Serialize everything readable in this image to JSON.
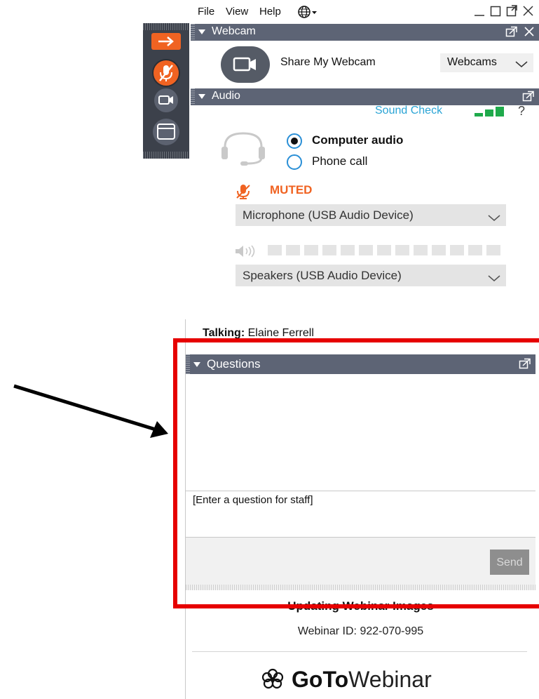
{
  "menubar": {
    "file": "File",
    "view": "View",
    "help": "Help",
    "language_icon": "globe-icon"
  },
  "window_controls": [
    "minimize-icon",
    "maximize-icon",
    "popout-icon",
    "close-icon"
  ],
  "strip": {
    "buttons": [
      "exit-arrow-icon",
      "muted-mic-icon",
      "webcam-icon",
      "screen-icon"
    ],
    "accent_color": "#f06322"
  },
  "webcam": {
    "header": "Webcam",
    "share_label": "Share My Webcam",
    "select_label": "Webcams"
  },
  "audio": {
    "header": "Audio",
    "sound_check": "Sound Check",
    "help": "?",
    "options": {
      "computer": "Computer audio",
      "phone": "Phone call",
      "selected": "computer"
    },
    "muted_label": "MUTED",
    "microphone": "Microphone (USB Audio Device)",
    "speakers": "Speakers (USB Audio Device)",
    "speaker_level": 0
  },
  "talking": {
    "label": "Talking:",
    "name": "Elaine Ferrell"
  },
  "questions": {
    "header": "Questions",
    "input_placeholder": "[Enter a question for staff]",
    "send_label": "Send"
  },
  "footer": {
    "title": "Updating Webinar Images",
    "webinar_id": "Webinar ID: 922-070-995",
    "brand_bold": "GoTo",
    "brand_regular": "Webinar"
  },
  "colors": {
    "header_bg": "#5d6475",
    "strip_bg": "#3c414b",
    "link": "#2aa4d5",
    "muted": "#f06322",
    "annotation": "#e60000",
    "level_green": "#1faa4b"
  }
}
